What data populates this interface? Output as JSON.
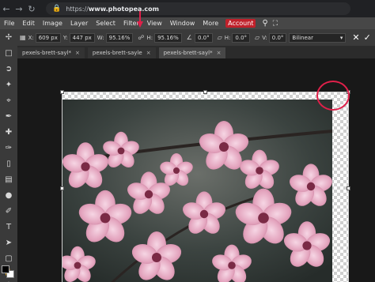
{
  "browser": {
    "url_prefix": "https://",
    "url_host": "www.photopea.com"
  },
  "menu": {
    "items": [
      "File",
      "Edit",
      "Image",
      "Layer",
      "Select",
      "Filter",
      "View",
      "Window",
      "More"
    ],
    "account_label": "Account"
  },
  "options": {
    "x_label": "X:",
    "x_value": "609 px",
    "y_label": "Y:",
    "y_value": "447 px",
    "w_label": "W:",
    "w_value": "95.16%",
    "h_label": "H:",
    "h_value": "95.16%",
    "angle_value": "0.0°",
    "hskew_label": "H:",
    "hskew_value": "0.0°",
    "vskew_label": "V:",
    "vskew_value": "0.0°",
    "interpolation": "Bilinear"
  },
  "tabs": [
    {
      "label": "pexels-brett-sayl",
      "modified": "*"
    },
    {
      "label": "pexels-brett-sayle",
      "modified": ""
    },
    {
      "label": "pexels-brett-sayl",
      "modified": "*"
    }
  ],
  "colors": {
    "annotation": "#e0204a",
    "account": "#c0212b"
  },
  "icons": [
    "search-icon",
    "fullscreen-icon",
    "link-icon",
    "commit-check-icon",
    "cancel-icon",
    "move-tool-icon"
  ]
}
